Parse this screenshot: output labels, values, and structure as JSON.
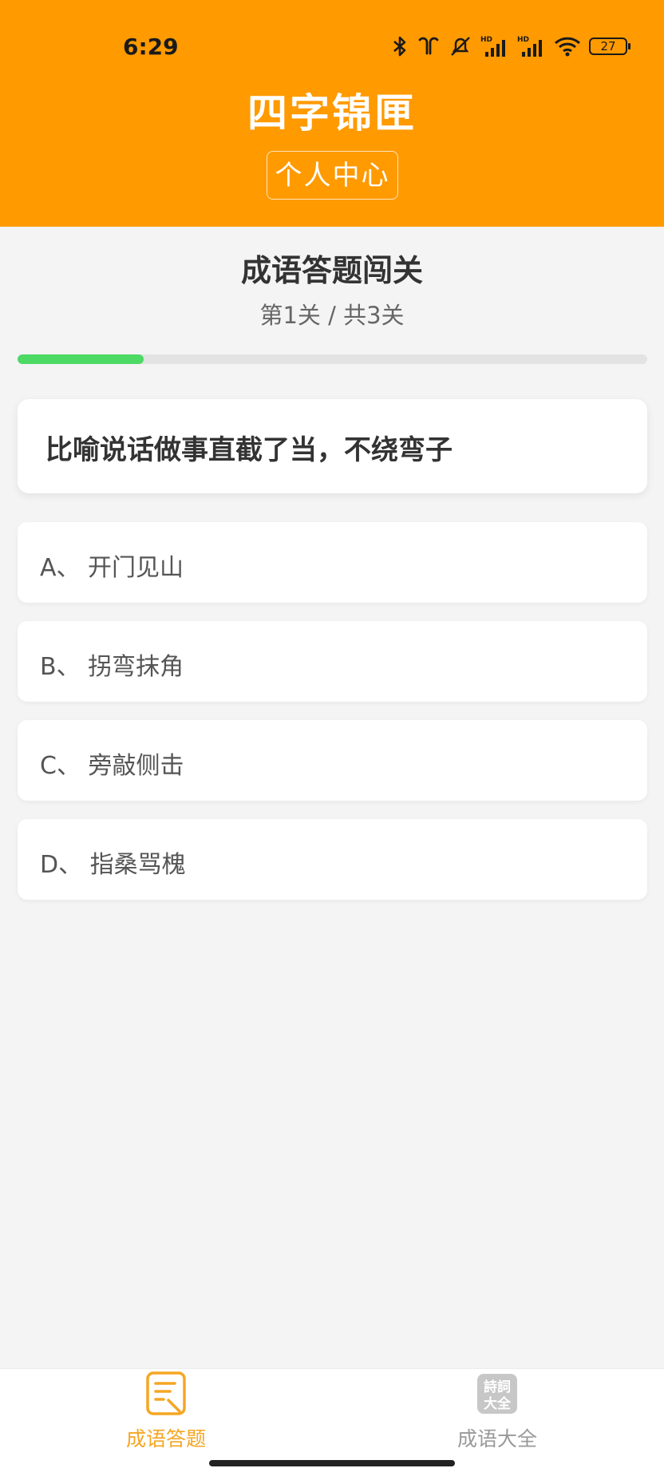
{
  "status_bar": {
    "time": "6:29",
    "battery": "27",
    "icons": [
      "bluetooth-icon",
      "earbuds-icon",
      "mute-icon",
      "hd-signal-icon",
      "hd-signal-icon",
      "wifi-icon",
      "battery-icon"
    ]
  },
  "header": {
    "title": "四字锦匣",
    "profile_button": "个人中心"
  },
  "quiz": {
    "title": "成语答题闯关",
    "level_info": "第1关 / 共3关",
    "progress": 0.2,
    "question": "比喻说话做事直截了当，不绕弯子",
    "options": [
      "A、 开门见山",
      "B、 拐弯抹角",
      "C、 旁敲侧击",
      "D、 指桑骂槐"
    ]
  },
  "bottom_nav": {
    "items": [
      {
        "label": "成语答题",
        "icon": "quiz-icon",
        "active": true
      },
      {
        "label": "成语大全",
        "icon": "poetry-book-icon",
        "active": false
      }
    ],
    "icon_text": [
      "詩詞",
      "大全"
    ]
  },
  "colors": {
    "header": "#ff9a00",
    "accent": "#f5a623",
    "progress": "#4cd964",
    "inactive": "#999999"
  }
}
